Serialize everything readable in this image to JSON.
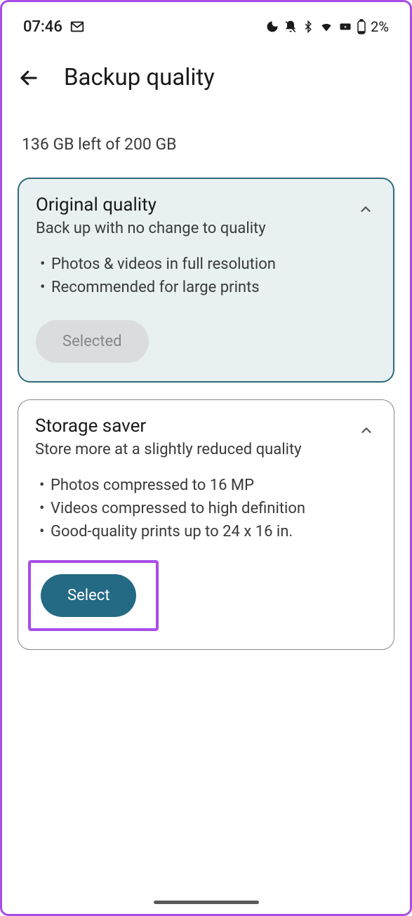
{
  "statusBar": {
    "time": "07:46",
    "batteryText": "2%"
  },
  "header": {
    "title": "Backup quality"
  },
  "storageInfo": "136 GB left of 200 GB",
  "cards": [
    {
      "title": "Original quality",
      "subtitle": "Back up with no change to quality",
      "bullets": [
        "Photos & videos in full resolution",
        "Recommended for large prints"
      ],
      "buttonLabel": "Selected"
    },
    {
      "title": "Storage saver",
      "subtitle": "Store more at a slightly reduced quality",
      "bullets": [
        "Photos compressed to 16 MP",
        "Videos compressed to high definition",
        "Good-quality prints up to 24 x 16 in."
      ],
      "buttonLabel": "Select"
    }
  ]
}
